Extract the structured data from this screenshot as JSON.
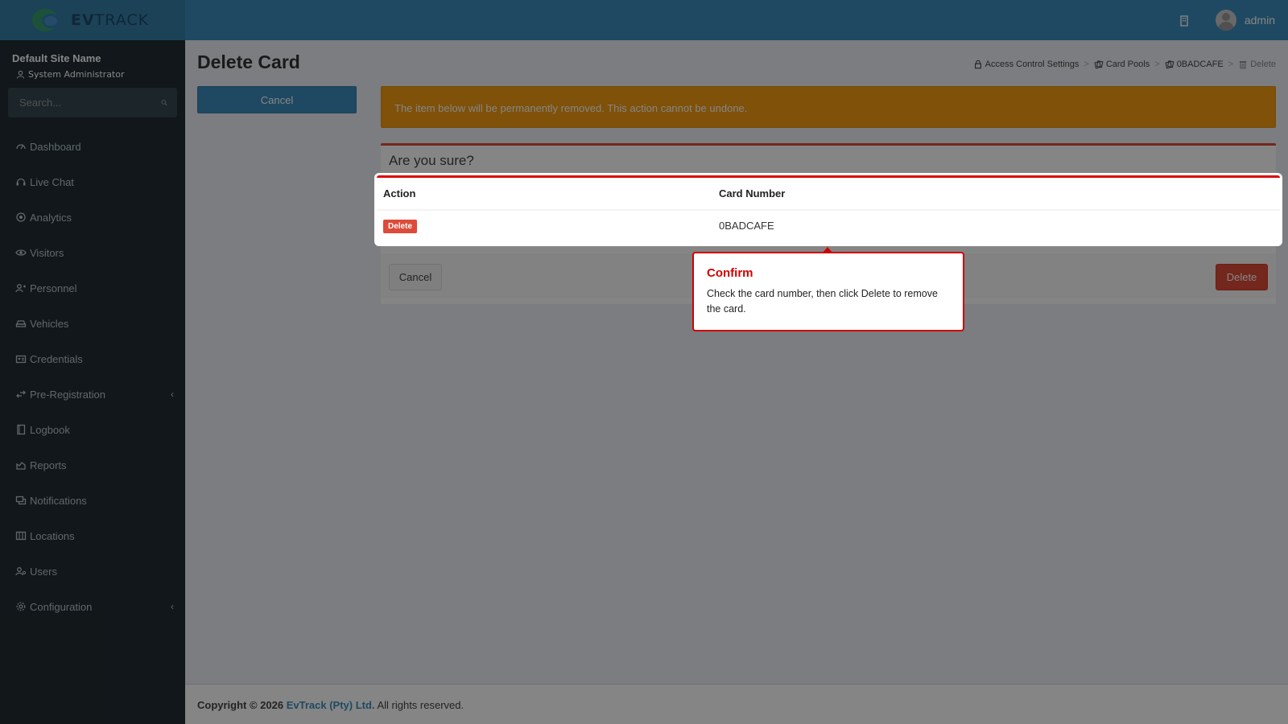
{
  "brand": {
    "name_bold": "EV",
    "name_rest": "TRACK"
  },
  "header": {
    "user_name": "admin"
  },
  "sidebar": {
    "site_name": "Default Site Name",
    "role": "System Administrator",
    "search_placeholder": "Search...",
    "items": [
      {
        "label": "Dashboard",
        "icon": "dashboard-icon"
      },
      {
        "label": "Live Chat",
        "icon": "headset-icon"
      },
      {
        "label": "Analytics",
        "icon": "analytics-icon"
      },
      {
        "label": "Visitors",
        "icon": "eye-icon"
      },
      {
        "label": "Personnel",
        "icon": "personnel-icon"
      },
      {
        "label": "Vehicles",
        "icon": "car-icon"
      },
      {
        "label": "Credentials",
        "icon": "id-card-icon"
      },
      {
        "label": "Pre-Registration",
        "icon": "arrows-icon",
        "expandable": true
      },
      {
        "label": "Logbook",
        "icon": "book-icon"
      },
      {
        "label": "Reports",
        "icon": "chart-icon"
      },
      {
        "label": "Notifications",
        "icon": "chat-icon"
      },
      {
        "label": "Locations",
        "icon": "map-icon"
      },
      {
        "label": "Users",
        "icon": "users-icon"
      },
      {
        "label": "Configuration",
        "icon": "gear-icon",
        "expandable": true
      }
    ]
  },
  "page": {
    "title": "Delete Card",
    "cancel_label": "Cancel",
    "breadcrumb": [
      {
        "label": "Access Control Settings",
        "icon": "lock-icon"
      },
      {
        "label": "Card Pools",
        "icon": "cards-icon"
      },
      {
        "label": "0BADCAFE",
        "icon": "card-icon"
      },
      {
        "label": "Delete",
        "icon": "trash-icon"
      }
    ],
    "warning": "The item below will be permanently removed. This action cannot be undone.",
    "box_title": "Are you sure?",
    "table": {
      "headers": [
        "Action",
        "Card Number"
      ],
      "row": {
        "action_label": "Delete",
        "card_number": "0BADCAFE"
      }
    },
    "footer_cancel": "Cancel",
    "footer_delete": "Delete"
  },
  "popover": {
    "title": "Confirm",
    "body": "Check the card number, then click Delete to remove the card."
  },
  "footer": {
    "copyright": "Copyright © 2026",
    "company": "EvTrack (Pty) Ltd.",
    "rights": "All rights reserved."
  },
  "colors": {
    "header": "#3c8dbc",
    "sidebar": "#222d32",
    "warning": "#f39c12",
    "danger": "#dd4b39",
    "spotlight_border": "#d00000"
  }
}
